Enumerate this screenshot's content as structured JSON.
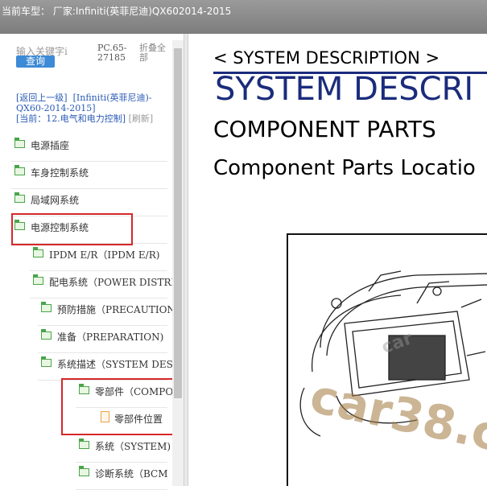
{
  "title": "当前车型：  厂家:Infiniti(英菲尼迪)QX602014-2015",
  "search": {
    "placeholder": "输入关键字i",
    "button": "查询"
  },
  "pc_code": "PC.65-27185",
  "fold_all": "折叠全部",
  "nav": {
    "back": "[返回上一级]",
    "model": "[Infiniti(英菲尼迪)-QX60-2014-2015]",
    "current": "[当前：12.电气和电力控制]",
    "refresh": "[刷新]"
  },
  "tree": [
    {
      "label": "电源插座"
    },
    {
      "label": "车身控制系统"
    },
    {
      "label": "局域网系统"
    },
    {
      "label": "电源控制系统"
    },
    {
      "label": "IPDM E/R（IPDM E/R)"
    },
    {
      "label": "配电系统（POWER DISTRI"
    },
    {
      "label": "预防措施（PRECAUTION"
    },
    {
      "label": "准备（PREPARATION)"
    },
    {
      "label": "系统描述（SYSTEM DES"
    },
    {
      "label": "零部件（COMPO"
    },
    {
      "label": "零部件位置"
    },
    {
      "label": "系统（SYSTEM)"
    },
    {
      "label": "诊断系统（BCM"
    }
  ],
  "doc": {
    "crumb": "< SYSTEM DESCRIPTION >",
    "heading": "SYSTEM DESCRI",
    "section": "COMPONENT PARTS",
    "subsection": "Component Parts Locatio"
  },
  "watermarks": {
    "url": "car38.c",
    "brand": "car"
  },
  "colors": {
    "link": "#2a5bb6",
    "highlight": "#d62828",
    "heading": "#1b2c7c"
  }
}
